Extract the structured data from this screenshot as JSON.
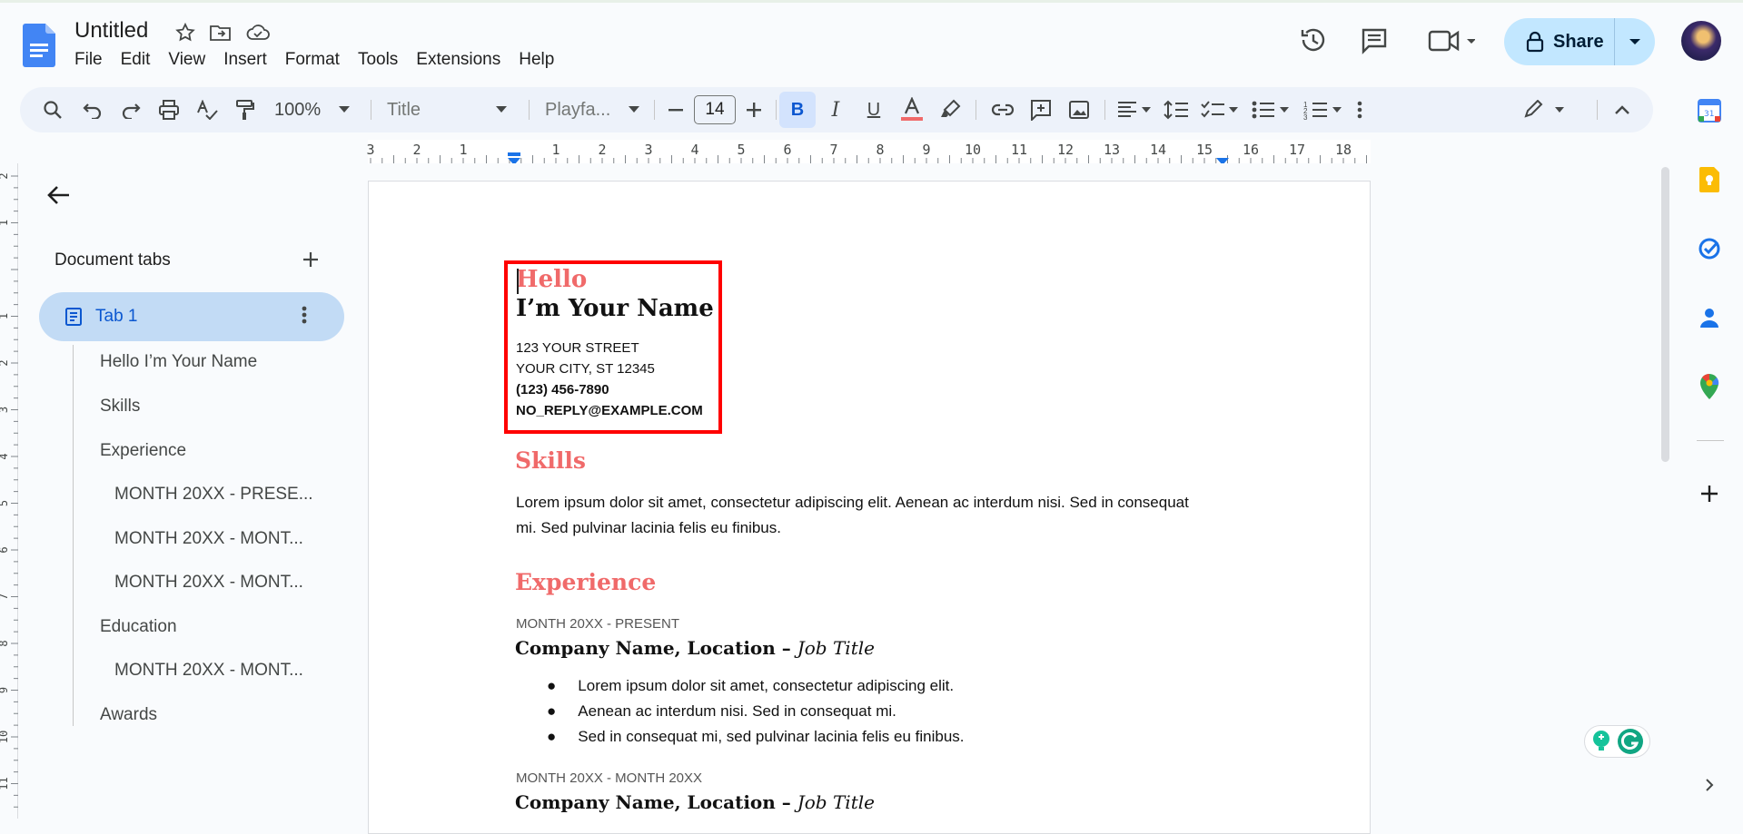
{
  "header": {
    "title": "Untitled",
    "menus": [
      "File",
      "Edit",
      "View",
      "Insert",
      "Format",
      "Tools",
      "Extensions",
      "Help"
    ],
    "share_label": "Share"
  },
  "toolbar": {
    "zoom": "100%",
    "style": "Title",
    "font": "Playfa...",
    "font_size": "14"
  },
  "ruler": {
    "labels": [
      "3",
      "2",
      "1",
      "",
      "1",
      "2",
      "3",
      "4",
      "5",
      "6",
      "7",
      "8",
      "9",
      "10",
      "11",
      "12",
      "13",
      "14",
      "15",
      "16",
      "17",
      "18"
    ],
    "vlabels": [
      "2",
      "1",
      "",
      "1",
      "2",
      "3",
      "4",
      "5",
      "6",
      "7",
      "8",
      "9",
      "10",
      "11"
    ]
  },
  "sidebar": {
    "title": "Document tabs",
    "tab_label": "Tab 1",
    "outline": [
      {
        "label": "Hello I’m Your Name",
        "level": 1
      },
      {
        "label": "Skills",
        "level": 1
      },
      {
        "label": "Experience",
        "level": 1
      },
      {
        "label": "MONTH 20XX - PRESE...",
        "level": 2
      },
      {
        "label": "MONTH 20XX - MONT...",
        "level": 2
      },
      {
        "label": "MONTH 20XX - MONT...",
        "level": 2
      },
      {
        "label": "Education",
        "level": 1
      },
      {
        "label": "MONTH 20XX - MONT...",
        "level": 2
      },
      {
        "label": "Awards",
        "level": 1
      }
    ]
  },
  "document": {
    "hello": "Hello",
    "name": "I’m Your Name",
    "street": "123 YOUR STREET",
    "city": "YOUR CITY, ST 12345",
    "phone": "(123) 456-7890",
    "email": "NO_REPLY@EXAMPLE.COM",
    "skills_heading": "Skills",
    "skills_line1": "Lorem ipsum dolor sit amet, consectetur adipiscing elit. Aenean ac interdum nisi. Sed in consequat",
    "skills_line2": "mi. Sed pulvinar lacinia felis eu finibus.",
    "experience_heading": "Experience",
    "job1_date": "MONTH 20XX - PRESENT",
    "job1_company": "Company Name, Location – ",
    "job1_title": "Job Title",
    "job1_bullets": [
      "Lorem ipsum dolor sit amet, consectetur adipiscing elit.",
      "Aenean ac interdum nisi. Sed in consequat mi.",
      "Sed in consequat mi, sed pulvinar lacinia felis eu finibus."
    ],
    "job2_date": "MONTH 20XX - MONTH 20XX",
    "job2_company": "Company Name, Location – ",
    "job2_title": "Job Title"
  },
  "colors": {
    "accent": "#f06a6a",
    "highlight_box": "#ff0000",
    "tab_active_bg": "#c2dbf5",
    "share_bg": "#c2e7ff"
  }
}
